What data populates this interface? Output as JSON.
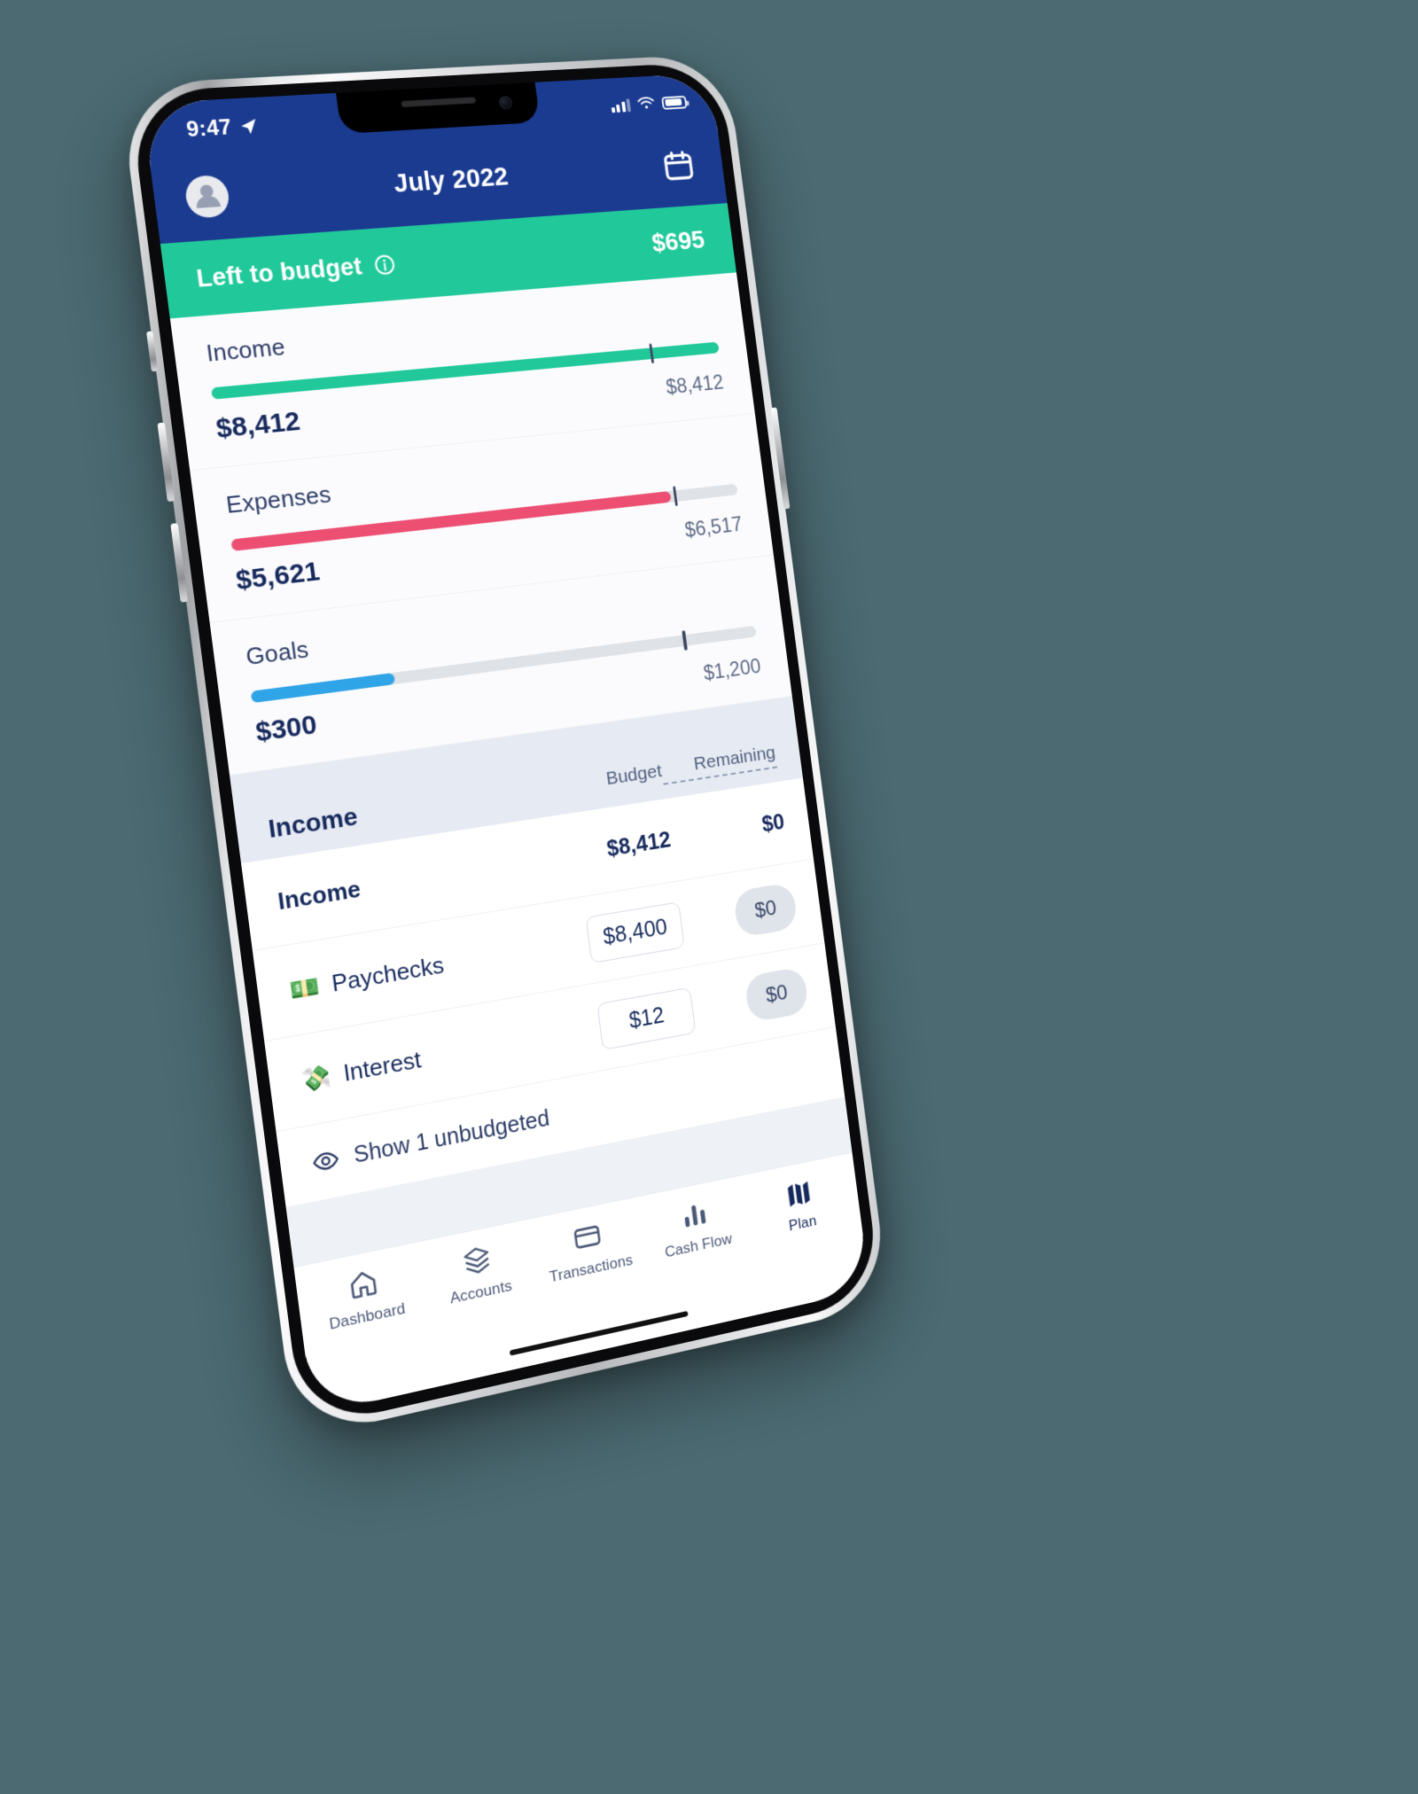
{
  "theme": {
    "navy": "#1b3b91",
    "green": "#21c99a",
    "pink": "#ec4f72",
    "blue": "#2fa4e7",
    "track": "#dfe2e7",
    "text_dark": "#16295c",
    "background": "#4b6a72"
  },
  "status_bar": {
    "time": "9:47",
    "location_icon": "location-arrow-icon",
    "signal_icon": "cellular-signal-icon",
    "wifi_icon": "wifi-icon",
    "battery_icon": "battery-icon"
  },
  "navbar": {
    "avatar_icon": "user-avatar-icon",
    "title": "July 2022",
    "calendar_icon": "calendar-icon"
  },
  "left_to_budget": {
    "label": "Left to budget",
    "info_icon": "info-icon",
    "amount": "$695"
  },
  "summary": [
    {
      "title": "Income",
      "actual": "$8,412",
      "total": "$8,412",
      "fill_pct": 100,
      "tick_pct": 86,
      "color": "#21c99a"
    },
    {
      "title": "Expenses",
      "actual": "$5,621",
      "total": "$6,517",
      "fill_pct": 86,
      "tick_pct": 87,
      "color": "#ec4f72"
    },
    {
      "title": "Goals",
      "actual": "$300",
      "total": "$1,200",
      "fill_pct": 27,
      "tick_pct": 85,
      "color": "#2fa4e7"
    }
  ],
  "table": {
    "section_title": "Income",
    "col_budget": "Budget",
    "col_remaining": "Remaining",
    "rows": [
      {
        "name": "Income",
        "emoji": "",
        "budget": "$8,412",
        "remaining": "$0",
        "is_summary": true,
        "budget_style": "plain",
        "remaining_style": "plain"
      },
      {
        "name": "Paychecks",
        "emoji": "💵",
        "budget": "$8,400",
        "remaining": "$0",
        "is_summary": false,
        "budget_style": "pill",
        "remaining_style": "chip"
      },
      {
        "name": "Interest",
        "emoji": "💸",
        "budget": "$12",
        "remaining": "$0",
        "is_summary": false,
        "budget_style": "pill",
        "remaining_style": "chip"
      }
    ],
    "show_unbudgeted": {
      "icon": "eye-icon",
      "label": "Show 1 unbudgeted"
    }
  },
  "tabbar": {
    "items": [
      {
        "label": "Dashboard",
        "icon": "home-icon",
        "active": false
      },
      {
        "label": "Accounts",
        "icon": "layers-icon",
        "active": false
      },
      {
        "label": "Transactions",
        "icon": "credit-card-icon",
        "active": false
      },
      {
        "label": "Cash Flow",
        "icon": "bar-chart-icon",
        "active": false
      },
      {
        "label": "Plan",
        "icon": "plan-bars-icon",
        "active": true
      }
    ]
  }
}
